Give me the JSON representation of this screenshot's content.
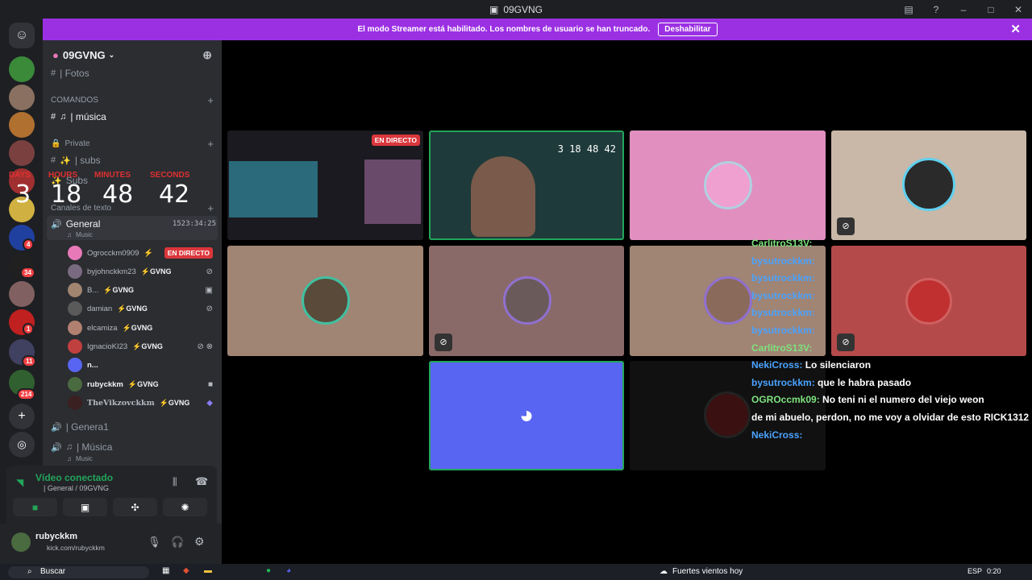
{
  "window": {
    "title": "09GVNG"
  },
  "banner": {
    "text": "El modo Streamer está habilitado. Los nombres de usuario se han truncado.",
    "button": "Deshabilitar"
  },
  "rail": {
    "badges": [
      "4",
      "34",
      "1",
      "11",
      "214"
    ]
  },
  "server": {
    "name": "09GVNG"
  },
  "channels": {
    "fotos": "| Fotos",
    "cat_comandos": "COMANDOS",
    "musica": "| música",
    "cat_private": "Private",
    "subs": "| subs",
    "subs2": "Subs",
    "cat_texto": "Canales de texto",
    "general": "General",
    "general_timer": "1523:34:25",
    "general_sub": "Music",
    "general1": "| Genera1",
    "musica2": "| Música",
    "musica2_sub": "Music"
  },
  "timer": {
    "labels": [
      "DAYS",
      "HOURS",
      "MINUTES",
      "SECONDS"
    ],
    "values": [
      "3",
      "18",
      "48",
      "42"
    ]
  },
  "users": [
    {
      "name": "Ogrocckm0909",
      "tag": "",
      "live": "EN DIRECTO",
      "color": "#e879b9"
    },
    {
      "name": "byjohnckkm23",
      "tag": "⚡GVNG",
      "color": "#7a6a80"
    },
    {
      "name": "B...",
      "tag": "⚡GVNG",
      "color": "#a08570"
    },
    {
      "name": "damian",
      "tag": "⚡GVNG",
      "color": "#5a5a5a"
    },
    {
      "name": "elcamiza",
      "tag": "⚡GVNG",
      "color": "#b08070"
    },
    {
      "name": "IgnacioKI23",
      "tag": "⚡GVNG",
      "color": "#c04040"
    },
    {
      "name": "n...",
      "tag": "",
      "color": "#5865f2"
    },
    {
      "name": "rubyckkm",
      "tag": "⚡GVNG",
      "color": "#4a6a40"
    },
    {
      "name": "TheVikzovckkm",
      "tag": "⚡GVNG",
      "color": "#3a2020"
    }
  ],
  "voice": {
    "status": "Vídeo conectado",
    "sub": "| General / 09GVNG"
  },
  "me": {
    "name": "rubyckkm",
    "status": "kick.com/rubyckkm"
  },
  "stream": {
    "live": "EN DIRECTO",
    "overlay": "3  18  48  42"
  },
  "chat": [
    {
      "name": "CarlitroS13V:",
      "text": "",
      "cls": "nm2"
    },
    {
      "name": "bysutrockkm:",
      "text": "",
      "cls": "nm"
    },
    {
      "name": "bysutrockkm:",
      "text": "",
      "cls": "nm"
    },
    {
      "name": "bysutrockkm:",
      "text": "",
      "cls": "nm"
    },
    {
      "name": "bysutrockkm:",
      "text": "",
      "cls": "nm"
    },
    {
      "name": "bysutrockkm:",
      "text": "",
      "cls": "nm"
    },
    {
      "name": "CarlitroS13V:",
      "text": "",
      "cls": "nm2"
    },
    {
      "name": "NekiCross:",
      "text": "Lo silenciaron",
      "cls": "nm"
    },
    {
      "name": "bysutrockkm:",
      "text": "que le habra pasado",
      "cls": "nm"
    },
    {
      "name": "OGROccmk09:",
      "text": "No teni ni el numero del viejo weon",
      "cls": "nm2"
    },
    {
      "name": "",
      "text": "de mi abuelo, perdon, no me voy a olvidar de esto RICK1312",
      "cls": "nm"
    },
    {
      "name": "NekiCross:",
      "text": "",
      "cls": "nm"
    }
  ],
  "taskbar": {
    "search": "Buscar",
    "weather": "Fuertes vientos hoy",
    "lang": "ESP",
    "time": "0:20"
  }
}
